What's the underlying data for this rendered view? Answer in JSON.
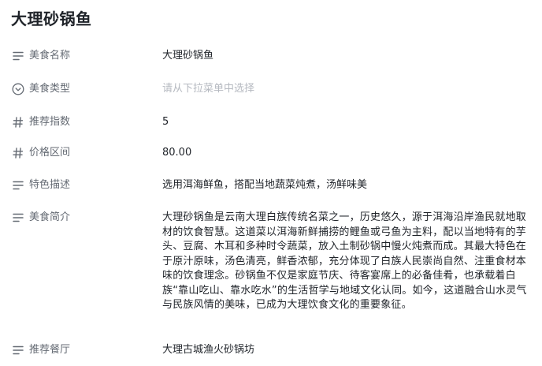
{
  "page_title": "大理砂锅鱼",
  "fields": {
    "name": {
      "label": "美食名称",
      "value": "大理砂锅鱼",
      "icon": "text-lines-icon"
    },
    "type": {
      "label": "美食类型",
      "placeholder": "请从下拉菜单中选择",
      "icon": "chevron-circle-down-icon"
    },
    "score": {
      "label": "推荐指数",
      "value": "5",
      "icon": "hash-icon"
    },
    "price": {
      "label": "价格区间",
      "value": "80.00",
      "icon": "hash-icon"
    },
    "feature": {
      "label": "特色描述",
      "value": "选用洱海鲜鱼，搭配当地蔬菜炖煮，汤鲜味美",
      "icon": "text-lines-icon"
    },
    "intro": {
      "label": "美食简介",
      "value": "大理砂锅鱼是云南大理白族传统名菜之一，历史悠久，源于洱海沿岸渔民就地取材的饮食智慧。这道菜以洱海新鲜捕捞的鲤鱼或弓鱼为主料，配以当地特有的芋头、豆腐、木耳和多种时令蔬菜，放入土制砂锅中慢火炖煮而成。其最大特色在于原汁原味，汤色清亮，鲜香浓郁，充分体现了白族人民崇尚自然、注重食材本味的饮食理念。砂锅鱼不仅是家庭节庆、待客宴席上的必备佳肴，也承载着白族“靠山吃山、靠水吃水”的生活哲学与地域文化认同。如今，这道融合山水灵气与民族风情的美味，已成为大理饮食文化的重要象征。",
      "icon": "text-lines-icon"
    },
    "restaurant": {
      "label": "推荐餐厅",
      "value": "大理古城渔火砂锅坊",
      "icon": "text-lines-icon"
    }
  }
}
